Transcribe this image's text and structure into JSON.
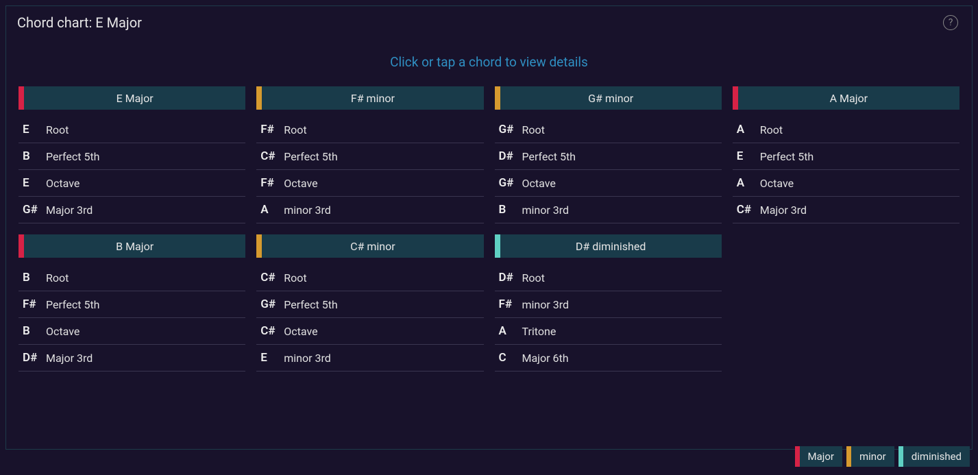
{
  "title": "Chord chart: E Major",
  "instruction": "Click or tap a chord to view details",
  "help_tooltip": "?",
  "colors": {
    "major": "#D62246",
    "minor": "#D69A2F",
    "diminished": "#5FD0C3"
  },
  "cards": [
    {
      "name": "E Major",
      "quality": "major",
      "notes": [
        {
          "n": "E",
          "i": "Root"
        },
        {
          "n": "B",
          "i": "Perfect 5th"
        },
        {
          "n": "E",
          "i": "Octave"
        },
        {
          "n": "G#",
          "i": "Major 3rd"
        }
      ]
    },
    {
      "name": "F# minor",
      "quality": "minor",
      "notes": [
        {
          "n": "F#",
          "i": "Root"
        },
        {
          "n": "C#",
          "i": "Perfect 5th"
        },
        {
          "n": "F#",
          "i": "Octave"
        },
        {
          "n": "A",
          "i": "minor 3rd"
        }
      ]
    },
    {
      "name": "G# minor",
      "quality": "minor",
      "notes": [
        {
          "n": "G#",
          "i": "Root"
        },
        {
          "n": "D#",
          "i": "Perfect 5th"
        },
        {
          "n": "G#",
          "i": "Octave"
        },
        {
          "n": "B",
          "i": "minor 3rd"
        }
      ]
    },
    {
      "name": "A Major",
      "quality": "major",
      "notes": [
        {
          "n": "A",
          "i": "Root"
        },
        {
          "n": "E",
          "i": "Perfect 5th"
        },
        {
          "n": "A",
          "i": "Octave"
        },
        {
          "n": "C#",
          "i": "Major 3rd"
        }
      ]
    },
    {
      "name": "B Major",
      "quality": "major",
      "notes": [
        {
          "n": "B",
          "i": "Root"
        },
        {
          "n": "F#",
          "i": "Perfect 5th"
        },
        {
          "n": "B",
          "i": "Octave"
        },
        {
          "n": "D#",
          "i": "Major 3rd"
        }
      ]
    },
    {
      "name": "C# minor",
      "quality": "minor",
      "notes": [
        {
          "n": "C#",
          "i": "Root"
        },
        {
          "n": "G#",
          "i": "Perfect 5th"
        },
        {
          "n": "C#",
          "i": "Octave"
        },
        {
          "n": "E",
          "i": "minor 3rd"
        }
      ]
    },
    {
      "name": "D# diminished",
      "quality": "diminished",
      "notes": [
        {
          "n": "D#",
          "i": "Root"
        },
        {
          "n": "F#",
          "i": "minor 3rd"
        },
        {
          "n": "A",
          "i": "Tritone"
        },
        {
          "n": "C",
          "i": "Major 6th"
        }
      ]
    }
  ],
  "legend": [
    {
      "label": "Major",
      "quality": "major"
    },
    {
      "label": "minor",
      "quality": "minor"
    },
    {
      "label": "diminished",
      "quality": "diminished"
    }
  ]
}
